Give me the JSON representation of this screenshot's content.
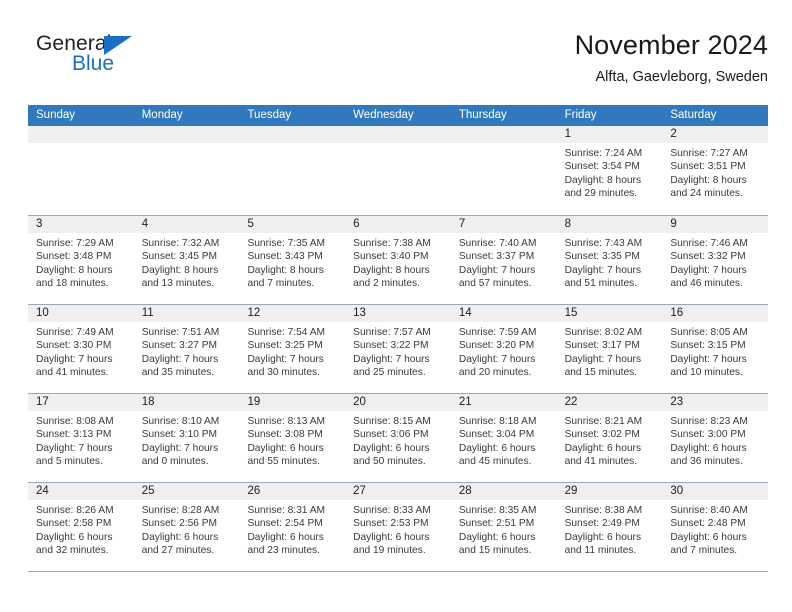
{
  "brand": {
    "name_dark": "General",
    "name_blue": "Blue",
    "accent_color": "#1a6fc4"
  },
  "header": {
    "title": "November 2024",
    "subtitle": "Alfta, Gaevleborg, Sweden",
    "header_bg_color": "#3179bd",
    "daynum_bg_color": "#efeff0"
  },
  "weekday_headers": [
    "Sunday",
    "Monday",
    "Tuesday",
    "Wednesday",
    "Thursday",
    "Friday",
    "Saturday"
  ],
  "labels": {
    "sunrise_prefix": "Sunrise:",
    "sunset_prefix": "Sunset:",
    "daylight_prefix": "Daylight:"
  },
  "weeks": [
    [
      {
        "day": "",
        "empty": true
      },
      {
        "day": "",
        "empty": true
      },
      {
        "day": "",
        "empty": true
      },
      {
        "day": "",
        "empty": true
      },
      {
        "day": "",
        "empty": true
      },
      {
        "day": "1",
        "sunrise": "Sunrise: 7:24 AM",
        "sunset": "Sunset: 3:54 PM",
        "daylight": "Daylight: 8 hours and 29 minutes."
      },
      {
        "day": "2",
        "sunrise": "Sunrise: 7:27 AM",
        "sunset": "Sunset: 3:51 PM",
        "daylight": "Daylight: 8 hours and 24 minutes."
      }
    ],
    [
      {
        "day": "3",
        "sunrise": "Sunrise: 7:29 AM",
        "sunset": "Sunset: 3:48 PM",
        "daylight": "Daylight: 8 hours and 18 minutes."
      },
      {
        "day": "4",
        "sunrise": "Sunrise: 7:32 AM",
        "sunset": "Sunset: 3:45 PM",
        "daylight": "Daylight: 8 hours and 13 minutes."
      },
      {
        "day": "5",
        "sunrise": "Sunrise: 7:35 AM",
        "sunset": "Sunset: 3:43 PM",
        "daylight": "Daylight: 8 hours and 7 minutes."
      },
      {
        "day": "6",
        "sunrise": "Sunrise: 7:38 AM",
        "sunset": "Sunset: 3:40 PM",
        "daylight": "Daylight: 8 hours and 2 minutes."
      },
      {
        "day": "7",
        "sunrise": "Sunrise: 7:40 AM",
        "sunset": "Sunset: 3:37 PM",
        "daylight": "Daylight: 7 hours and 57 minutes."
      },
      {
        "day": "8",
        "sunrise": "Sunrise: 7:43 AM",
        "sunset": "Sunset: 3:35 PM",
        "daylight": "Daylight: 7 hours and 51 minutes."
      },
      {
        "day": "9",
        "sunrise": "Sunrise: 7:46 AM",
        "sunset": "Sunset: 3:32 PM",
        "daylight": "Daylight: 7 hours and 46 minutes."
      }
    ],
    [
      {
        "day": "10",
        "sunrise": "Sunrise: 7:49 AM",
        "sunset": "Sunset: 3:30 PM",
        "daylight": "Daylight: 7 hours and 41 minutes."
      },
      {
        "day": "11",
        "sunrise": "Sunrise: 7:51 AM",
        "sunset": "Sunset: 3:27 PM",
        "daylight": "Daylight: 7 hours and 35 minutes."
      },
      {
        "day": "12",
        "sunrise": "Sunrise: 7:54 AM",
        "sunset": "Sunset: 3:25 PM",
        "daylight": "Daylight: 7 hours and 30 minutes."
      },
      {
        "day": "13",
        "sunrise": "Sunrise: 7:57 AM",
        "sunset": "Sunset: 3:22 PM",
        "daylight": "Daylight: 7 hours and 25 minutes."
      },
      {
        "day": "14",
        "sunrise": "Sunrise: 7:59 AM",
        "sunset": "Sunset: 3:20 PM",
        "daylight": "Daylight: 7 hours and 20 minutes."
      },
      {
        "day": "15",
        "sunrise": "Sunrise: 8:02 AM",
        "sunset": "Sunset: 3:17 PM",
        "daylight": "Daylight: 7 hours and 15 minutes."
      },
      {
        "day": "16",
        "sunrise": "Sunrise: 8:05 AM",
        "sunset": "Sunset: 3:15 PM",
        "daylight": "Daylight: 7 hours and 10 minutes."
      }
    ],
    [
      {
        "day": "17",
        "sunrise": "Sunrise: 8:08 AM",
        "sunset": "Sunset: 3:13 PM",
        "daylight": "Daylight: 7 hours and 5 minutes."
      },
      {
        "day": "18",
        "sunrise": "Sunrise: 8:10 AM",
        "sunset": "Sunset: 3:10 PM",
        "daylight": "Daylight: 7 hours and 0 minutes."
      },
      {
        "day": "19",
        "sunrise": "Sunrise: 8:13 AM",
        "sunset": "Sunset: 3:08 PM",
        "daylight": "Daylight: 6 hours and 55 minutes."
      },
      {
        "day": "20",
        "sunrise": "Sunrise: 8:15 AM",
        "sunset": "Sunset: 3:06 PM",
        "daylight": "Daylight: 6 hours and 50 minutes."
      },
      {
        "day": "21",
        "sunrise": "Sunrise: 8:18 AM",
        "sunset": "Sunset: 3:04 PM",
        "daylight": "Daylight: 6 hours and 45 minutes."
      },
      {
        "day": "22",
        "sunrise": "Sunrise: 8:21 AM",
        "sunset": "Sunset: 3:02 PM",
        "daylight": "Daylight: 6 hours and 41 minutes."
      },
      {
        "day": "23",
        "sunrise": "Sunrise: 8:23 AM",
        "sunset": "Sunset: 3:00 PM",
        "daylight": "Daylight: 6 hours and 36 minutes."
      }
    ],
    [
      {
        "day": "24",
        "sunrise": "Sunrise: 8:26 AM",
        "sunset": "Sunset: 2:58 PM",
        "daylight": "Daylight: 6 hours and 32 minutes."
      },
      {
        "day": "25",
        "sunrise": "Sunrise: 8:28 AM",
        "sunset": "Sunset: 2:56 PM",
        "daylight": "Daylight: 6 hours and 27 minutes."
      },
      {
        "day": "26",
        "sunrise": "Sunrise: 8:31 AM",
        "sunset": "Sunset: 2:54 PM",
        "daylight": "Daylight: 6 hours and 23 minutes."
      },
      {
        "day": "27",
        "sunrise": "Sunrise: 8:33 AM",
        "sunset": "Sunset: 2:53 PM",
        "daylight": "Daylight: 6 hours and 19 minutes."
      },
      {
        "day": "28",
        "sunrise": "Sunrise: 8:35 AM",
        "sunset": "Sunset: 2:51 PM",
        "daylight": "Daylight: 6 hours and 15 minutes."
      },
      {
        "day": "29",
        "sunrise": "Sunrise: 8:38 AM",
        "sunset": "Sunset: 2:49 PM",
        "daylight": "Daylight: 6 hours and 11 minutes."
      },
      {
        "day": "30",
        "sunrise": "Sunrise: 8:40 AM",
        "sunset": "Sunset: 2:48 PM",
        "daylight": "Daylight: 6 hours and 7 minutes."
      }
    ]
  ]
}
